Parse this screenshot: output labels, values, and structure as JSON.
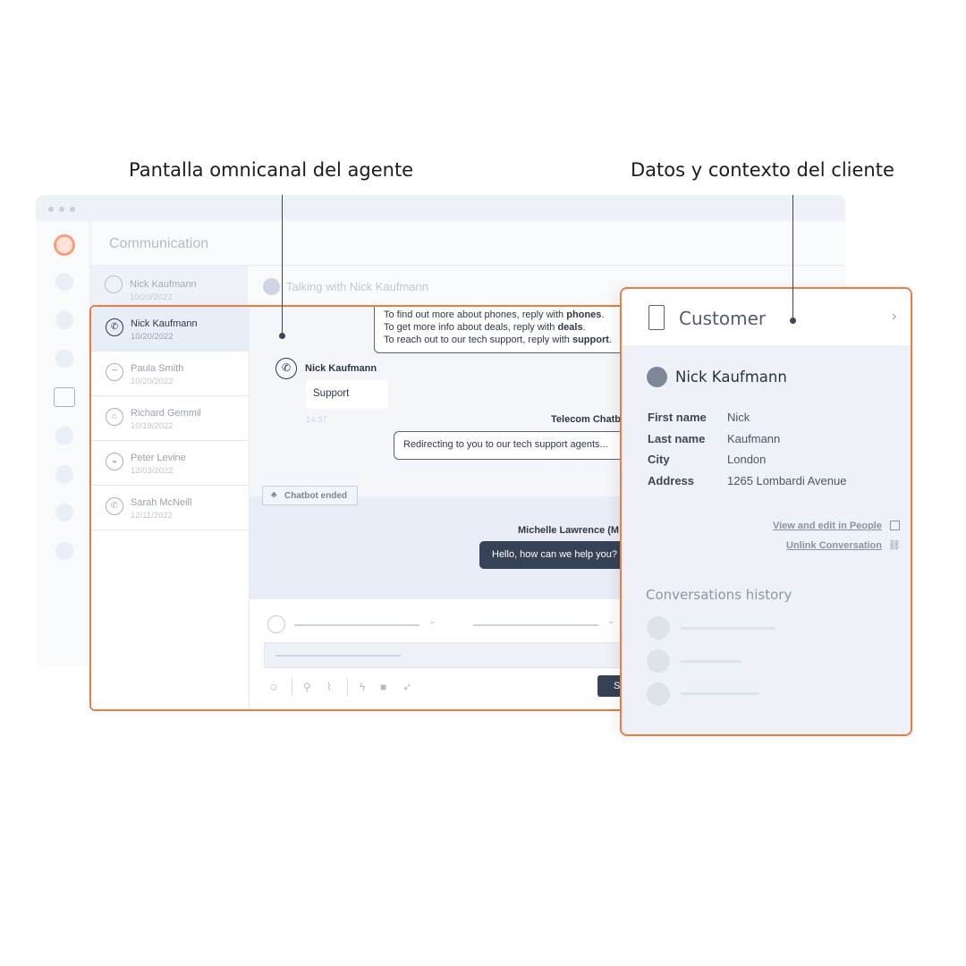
{
  "annotations": {
    "left": "Pantalla omnicanal del agente",
    "right": "Datos y contexto del cliente"
  },
  "app": {
    "title": "Communication",
    "chat_header": "Talking with Nick Kaufmann",
    "accent": "#f07a3f"
  },
  "conversations": [
    {
      "name": "Nick Kaufmann",
      "date": "10/20/2022",
      "icon": "whatsapp-icon",
      "selected": true
    },
    {
      "name": "Paula Smith",
      "date": "10/20/2022",
      "icon": "chat-icon"
    },
    {
      "name": "Richard Gemmil",
      "date": "10/19/2022",
      "icon": "home-icon"
    },
    {
      "name": "Peter Levine",
      "date": "12/03/2022",
      "icon": "messenger-icon"
    },
    {
      "name": "Sarah McNeill",
      "date": "12/11/2022",
      "icon": "viber-icon"
    }
  ],
  "background_item": {
    "name": "Nick Kaufmann",
    "date": "10/20/2022"
  },
  "chat": {
    "bot_lines": [
      {
        "text": "To find out more about phones, reply with ",
        "bold": "phones",
        "end": "."
      },
      {
        "text": "To get more info about deals, reply with ",
        "bold": "deals",
        "end": "."
      },
      {
        "text": "To reach out to our tech support, reply with ",
        "bold": "support",
        "end": "."
      }
    ],
    "customer_name": "Nick Kaufmann",
    "customer_msg": "Support",
    "time": "14:37",
    "bot_name": "Telecom Chatb",
    "bot_msg": "Redirecting to you to our tech support agents...",
    "chatbot_ended": "Chatbot ended",
    "agent_name": "Michelle Lawrence (M",
    "agent_msg": "Hello, how can we help you?",
    "send_label": "S"
  },
  "customer": {
    "title": "Customer",
    "name": "Nick Kaufmann",
    "fields": [
      {
        "k": "First name",
        "v": "Nick"
      },
      {
        "k": "Last name",
        "v": "Kaufmann"
      },
      {
        "k": "City",
        "v": "London"
      },
      {
        "k": "Address",
        "v": "1265 Lombardi Avenue"
      }
    ],
    "view_link": "View and edit in People",
    "unlink": "Unlink Conversation",
    "history_title": "Conversations history"
  }
}
